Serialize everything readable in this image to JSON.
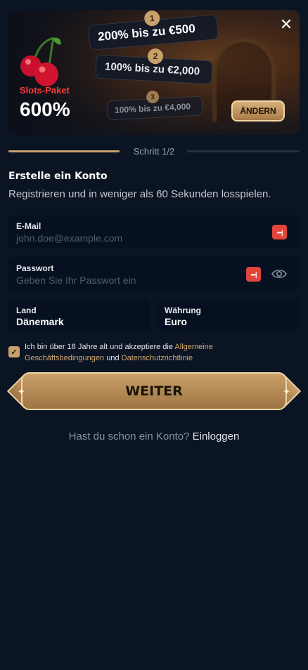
{
  "banner": {
    "package_label": "Slots-Paket",
    "package_value": "600%",
    "tiers": [
      {
        "number": "1",
        "label": "200% bis zu €500"
      },
      {
        "number": "2",
        "label": "100% bis zu €2,000"
      },
      {
        "number": "3",
        "label": "100% bis zu €4,000"
      }
    ],
    "change_label": "ÄNDERN",
    "close_icon": "close-icon"
  },
  "progress": {
    "text": "Schritt 1/2",
    "step": 1,
    "total": 2
  },
  "form": {
    "title": "Erstelle ein Konto",
    "subtitle": "Registrieren und in weniger als 60 Sekunden losspielen.",
    "email": {
      "label": "E-Mail",
      "placeholder": "john.doe@example.com",
      "value": ""
    },
    "password": {
      "label": "Passwort",
      "placeholder": "Geben Sie Ihr Passwort ein",
      "value": ""
    },
    "country": {
      "label": "Land",
      "value": "Dänemark"
    },
    "currency": {
      "label": "Währung",
      "value": "Euro"
    },
    "terms": {
      "checked": true,
      "prefix": "Ich bin über 18 Jahre alt und akzeptiere die ",
      "link1": "Allgemeine Geschäftsbedingungen",
      "middle": " und ",
      "link2": "Datenschutzrichtlinie"
    },
    "submit_label": "WEITER"
  },
  "footer": {
    "question": "Hast du schon ein Konto?",
    "login_label": "Einloggen"
  },
  "colors": {
    "accent": "#c8a06c",
    "background": "#0b1422",
    "field": "#061020",
    "password_manager": "#e2453c",
    "package_label": "#ff3b3b"
  }
}
